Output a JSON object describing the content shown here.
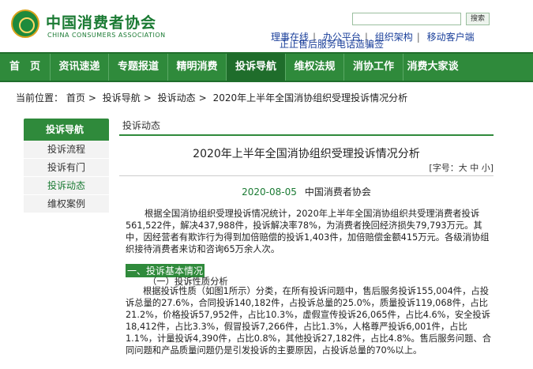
{
  "header": {
    "logo_cn": "中国消费者协会",
    "logo_en": "CHINA CONSUMERS ASSOCIATION",
    "search_button": "搜索",
    "search_placeholder": "",
    "toplinks": [
      "理事在线",
      "办公平台",
      "组织架构",
      "移动客户端"
    ],
    "overlay_text": "正止售后服务电话造骗签"
  },
  "nav": {
    "items": [
      {
        "label": "首　页",
        "width": 64
      },
      {
        "label": "资讯速递",
        "width": 74
      },
      {
        "label": "专题报道",
        "width": 75
      },
      {
        "label": "精明消费",
        "width": 74
      },
      {
        "label": "投诉导航",
        "width": 75
      },
      {
        "label": "维权法规",
        "width": 74
      },
      {
        "label": "消协工作",
        "width": 75
      },
      {
        "label": "消费大家谈",
        "width": 74
      }
    ],
    "active_index": 4
  },
  "breadcrumb": {
    "prefix": "当前位置：",
    "items": [
      "首页",
      "投诉导航",
      "投诉动态",
      "2020年上半年全国消协组织受理投诉情况分析"
    ]
  },
  "sidebar": {
    "title": "投诉导航",
    "items": [
      "投诉流程",
      "投诉有门",
      "投诉动态",
      "维权案例"
    ],
    "active_index": 2
  },
  "main": {
    "section_label": "投诉动态",
    "title": "2020年上半年全国消协组织受理投诉情况分析",
    "font_size_label": "[字号：大 中 小]",
    "date": "2020-08-05",
    "source": "中国消费者协会",
    "para1": "根据全国消协组织受理投诉情况统计，2020年上半年全国消协组织共受理消费者投诉561,522件，解决437,988件，投诉解决率78%，为消费者挽回经济损失79,793万元。其中，因经营者有欺诈行为得到加倍赔偿的投诉1,403件，加倍赔偿金额415万元。各级消协组织接待消费者来访和咨询65万余人次。",
    "section1": "一、投诉基本情况",
    "sub1": "（一）投诉性质分析",
    "para2": "根据投诉性质（如图1所示）分类，在所有投诉问题中，售后服务投诉155,004件，占投诉总量的27.6%，合同投诉140,182件，占投诉总量的25.0%，质量投诉119,068件，占比21.2%，价格投诉57,952件，占比10.3%，虚假宣传投诉26,065件，占比4.6%，安全投诉18,412件，占比3.3%，假冒投诉7,266件，占比1.3%，人格尊严投诉6,001件，占比1.1%，计量投诉4,390件，占比0.8%，其他投诉27,182件，占比4.8%。售后服务问题、合同问题和产品质量问题仍是引发投诉的主要原因，占投诉总量的70%以上。"
  },
  "colors": {
    "brand_green": "#2f8a3b",
    "dark_green": "#1f6d2b",
    "link_blue": "#1a3f9a"
  }
}
